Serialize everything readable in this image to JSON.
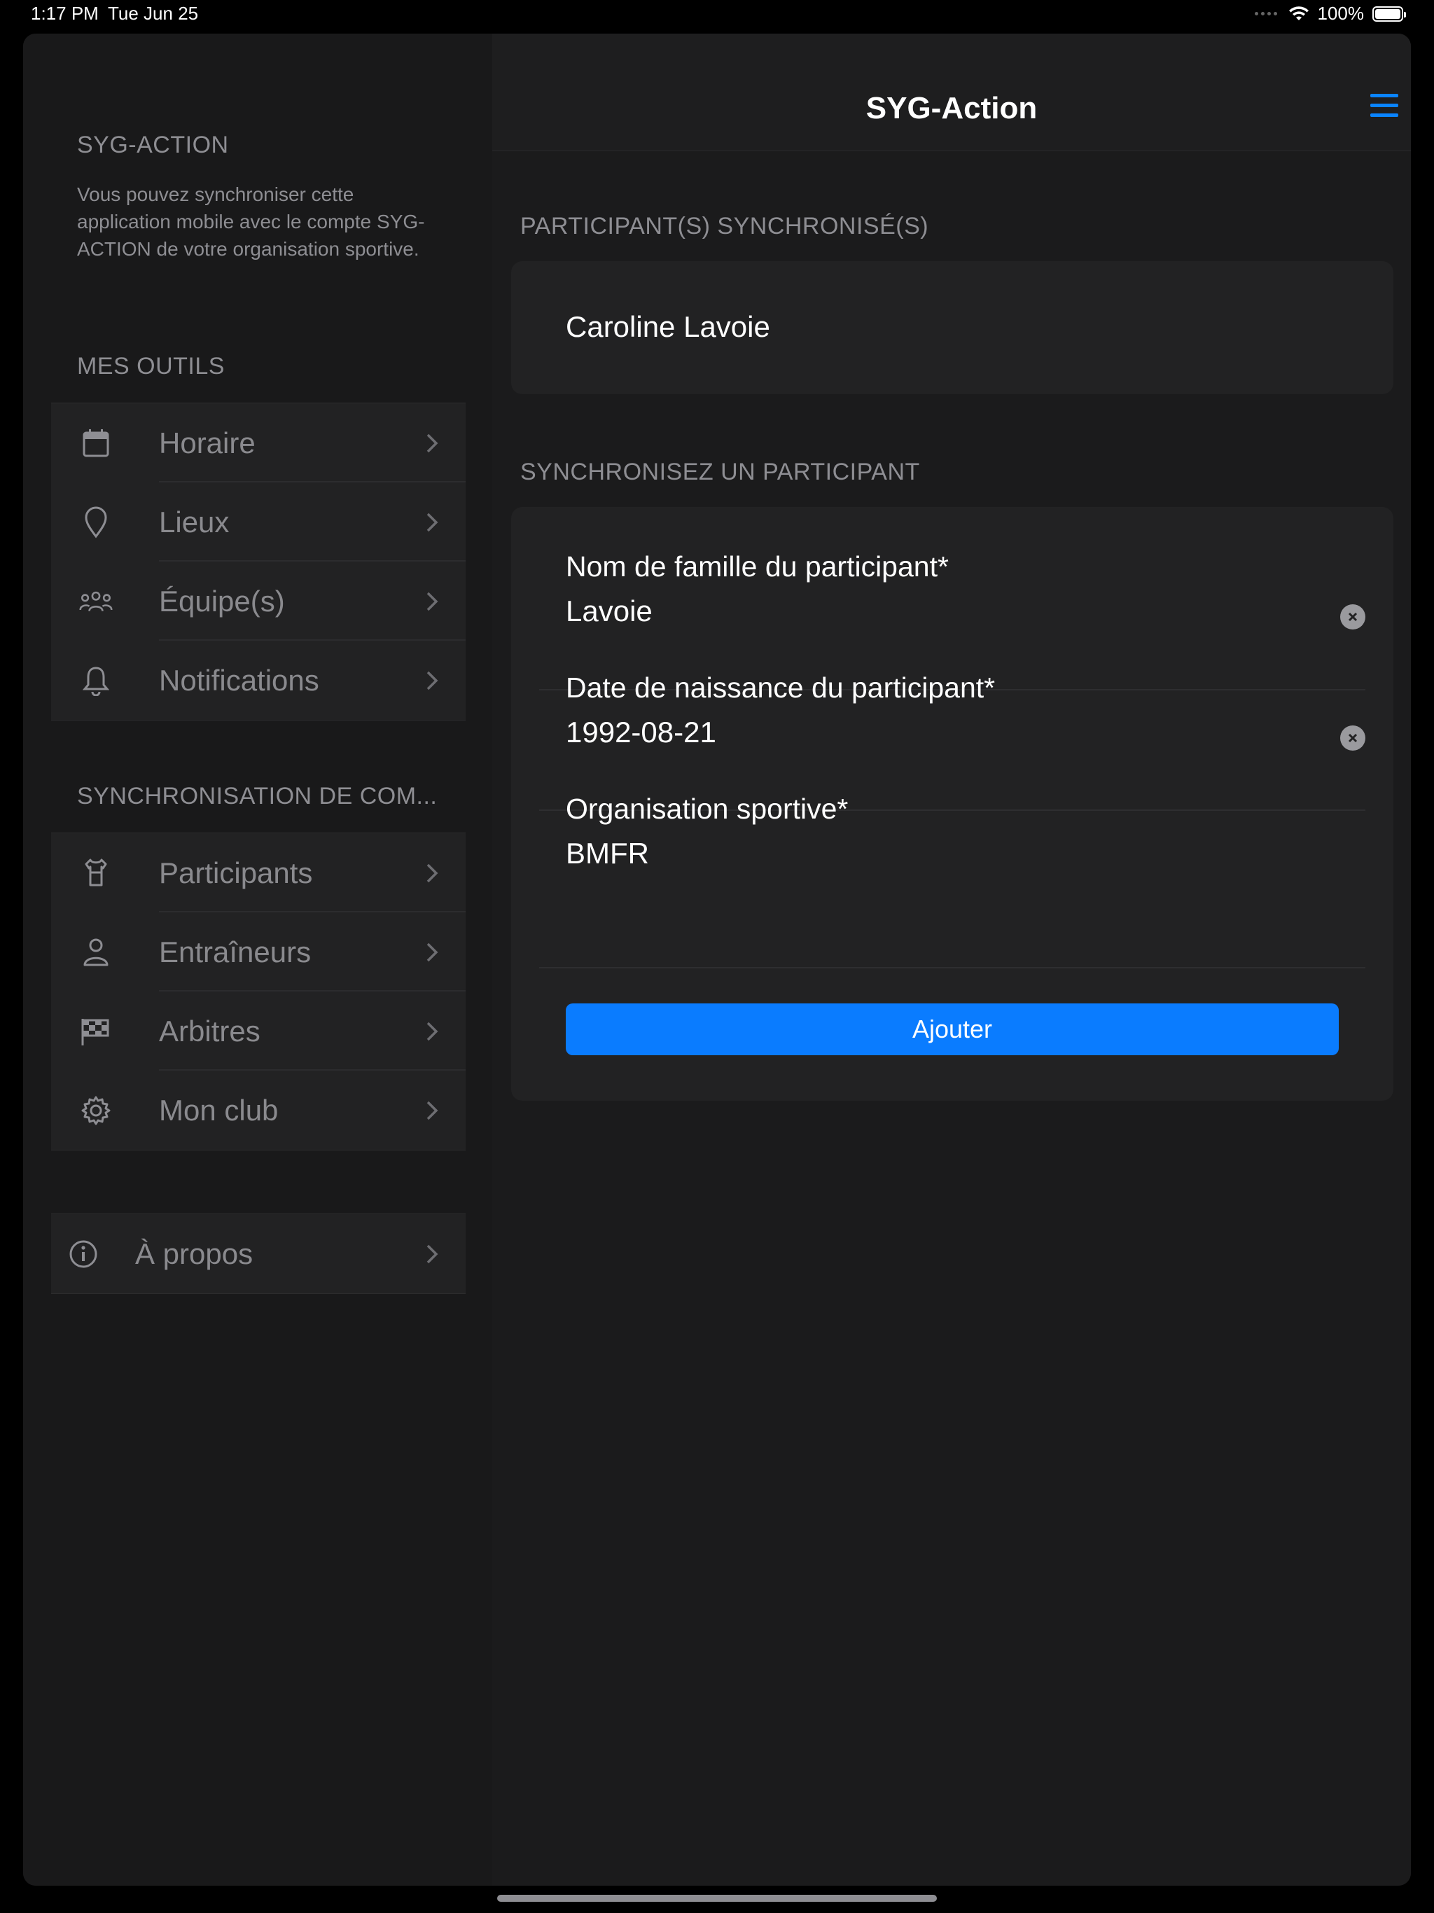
{
  "status_bar": {
    "time": "1:17 PM",
    "date": "Tue Jun 25",
    "battery": "100%",
    "icons": [
      "cellular-icon",
      "wifi-icon",
      "battery-icon"
    ]
  },
  "sidebar": {
    "app_section_title": "SYG-ACTION",
    "description": "Vous pouvez synchroniser cette application mobile avec le compte SYG-ACTION de votre organisation sportive.",
    "tools_title": "MES OUTILS",
    "tools": [
      {
        "label": "Horaire",
        "icon": "calendar-icon"
      },
      {
        "label": "Lieux",
        "icon": "location-pin-icon"
      },
      {
        "label": "Équipe(s)",
        "icon": "team-icon"
      },
      {
        "label": "Notifications",
        "icon": "bell-icon"
      }
    ],
    "sync_title": "SYNCHRONISATION DE COM...",
    "sync_items": [
      {
        "label": "Participants",
        "icon": "jersey-icon"
      },
      {
        "label": "Entraîneurs",
        "icon": "person-icon"
      },
      {
        "label": "Arbitres",
        "icon": "checkered-flag-icon"
      },
      {
        "label": "Mon club",
        "icon": "gear-icon"
      }
    ],
    "about": {
      "label": "À propos",
      "icon": "info-icon"
    }
  },
  "main": {
    "title": "SYG-Action",
    "synced_header": "PARTICIPANT(S) SYNCHRONISÉ(S)",
    "synced_participants": [
      "Caroline Lavoie"
    ],
    "sync_header": "SYNCHRONISEZ UN PARTICIPANT",
    "form": {
      "last_name_label": "Nom de famille du participant*",
      "last_name_value": "Lavoie",
      "birthdate_label": "Date de naissance du participant*",
      "birthdate_value": "1992-08-21",
      "org_label": "Organisation sportive*",
      "org_value": "BMFR",
      "submit_label": "Ajouter"
    }
  },
  "colors": {
    "accent": "#0a84ff",
    "button": "#0a7cff",
    "background": "#1b1b1c",
    "secondary_text": "#8e8e93"
  }
}
